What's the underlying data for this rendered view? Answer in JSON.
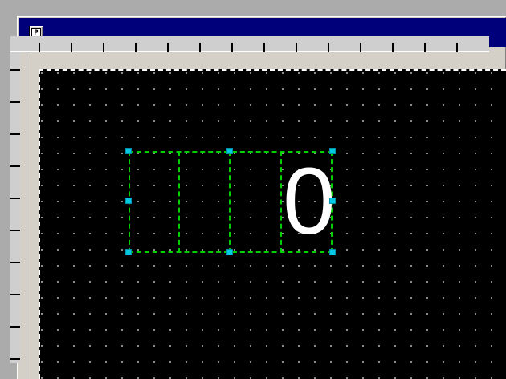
{
  "window": {
    "app_icon_letter": "P"
  },
  "canvas": {
    "display_object": {
      "type": "numeric-display",
      "digit_slots": 4,
      "value_text": "0"
    }
  },
  "colors": {
    "title_bar": "#00007b",
    "canvas_background": "#000000",
    "grid_dot": "#a0a0a0",
    "selection_outline": "#00d000",
    "handle": "#00c8e0",
    "digit": "#ffffff"
  }
}
